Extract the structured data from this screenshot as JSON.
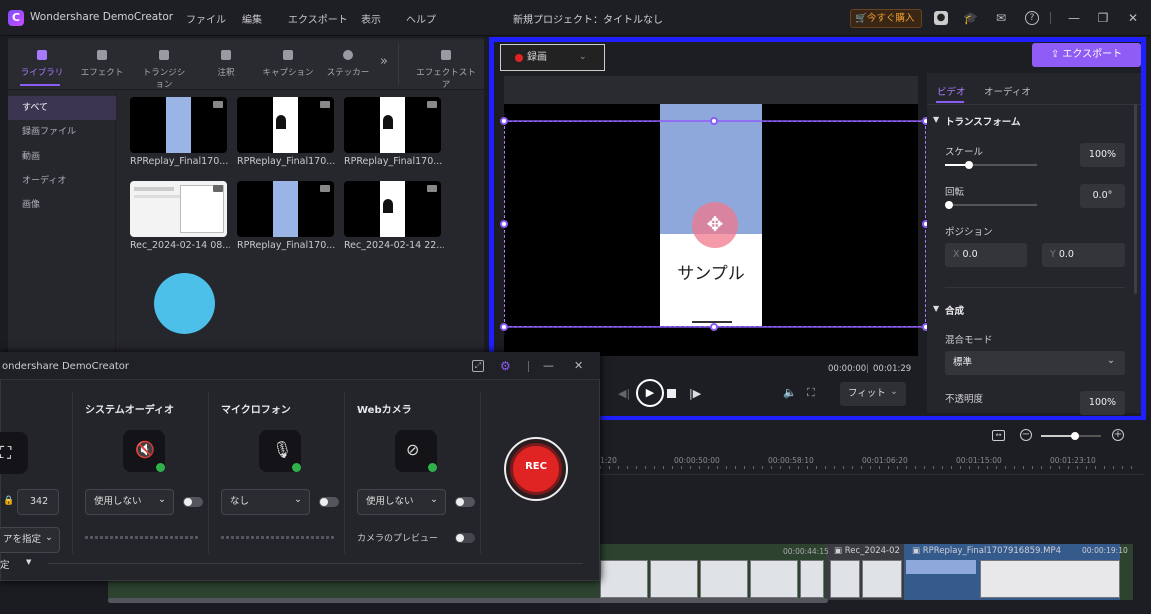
{
  "titlebar": {
    "app_name": "Wondershare DemoCreator",
    "menus": [
      "ファイル",
      "編集",
      "エクスポート",
      "表示",
      "ヘルプ"
    ],
    "project_title": "新規プロジェクト：タイトルなし",
    "buy_label": "今すぐ購入"
  },
  "library": {
    "tabs": [
      "ライブラリ",
      "エフェクト",
      "トランジション",
      "注釈",
      "キャプション",
      "ステッカー",
      "エフェクトストア"
    ],
    "more": "»",
    "categories": [
      "すべて",
      "録画ファイル",
      "動画",
      "オーディオ",
      "画像"
    ],
    "media": [
      {
        "name": "RPReplay_Final170..."
      },
      {
        "name": "RPReplay_Final170..."
      },
      {
        "name": "RPReplay_Final170..."
      },
      {
        "name": "Rec_2024-02-14 08..."
      },
      {
        "name": "RPReplay_Final170..."
      },
      {
        "name": "Rec_2024-02-14 22..."
      }
    ]
  },
  "recorder": {
    "title": "ondershare DemoCreator",
    "sections": {
      "system_audio": "システムオーディオ",
      "microphone": "マイクロフォン",
      "webcam": "Webカメラ"
    },
    "resolution_value": "342",
    "area_select": "アを指定",
    "settings_label": "定",
    "system_audio_value": "使用しない",
    "microphone_value": "なし",
    "webcam_value": "使用しない",
    "camera_preview": "カメラのプレビュー",
    "rec_label": "REC"
  },
  "preview": {
    "record_dropdown": "録画",
    "export_label": "エクスポート",
    "sample_text": "サンプル",
    "time_current": "00:00:00",
    "time_total": "00:01:29",
    "fit_label": "フィット"
  },
  "properties": {
    "tabs": [
      "ビデオ",
      "オーディオ"
    ],
    "transform_heading": "トランスフォーム",
    "scale_label": "スケール",
    "scale_value": "100%",
    "rotation_label": "回転",
    "rotation_value": "0.0°",
    "position_label": "ポジション",
    "pos_x_label": "X",
    "pos_x": "0.0",
    "pos_y_label": "Y",
    "pos_y": "0.0",
    "composite_heading": "合成",
    "blend_label": "混合モード",
    "blend_value": "標準",
    "opacity_label": "不透明度",
    "opacity_value": "100%"
  },
  "timeline": {
    "timecodes": [
      "1:20",
      "00:00:50:00",
      "00:00:58:10",
      "00:01:06:20",
      "00:01:15:00",
      "00:01:23:10"
    ],
    "clip_labels": [
      "00:00:44:15",
      "Rec_2024-02",
      "RPReplay_Final1707916859.MP4",
      "00:00:19:10"
    ]
  },
  "colors": {
    "accent": "#8b5cf6",
    "highlight_frame": "#1f1fff",
    "rec_red": "#e02424",
    "blue_dot": "#4cc0e8"
  }
}
